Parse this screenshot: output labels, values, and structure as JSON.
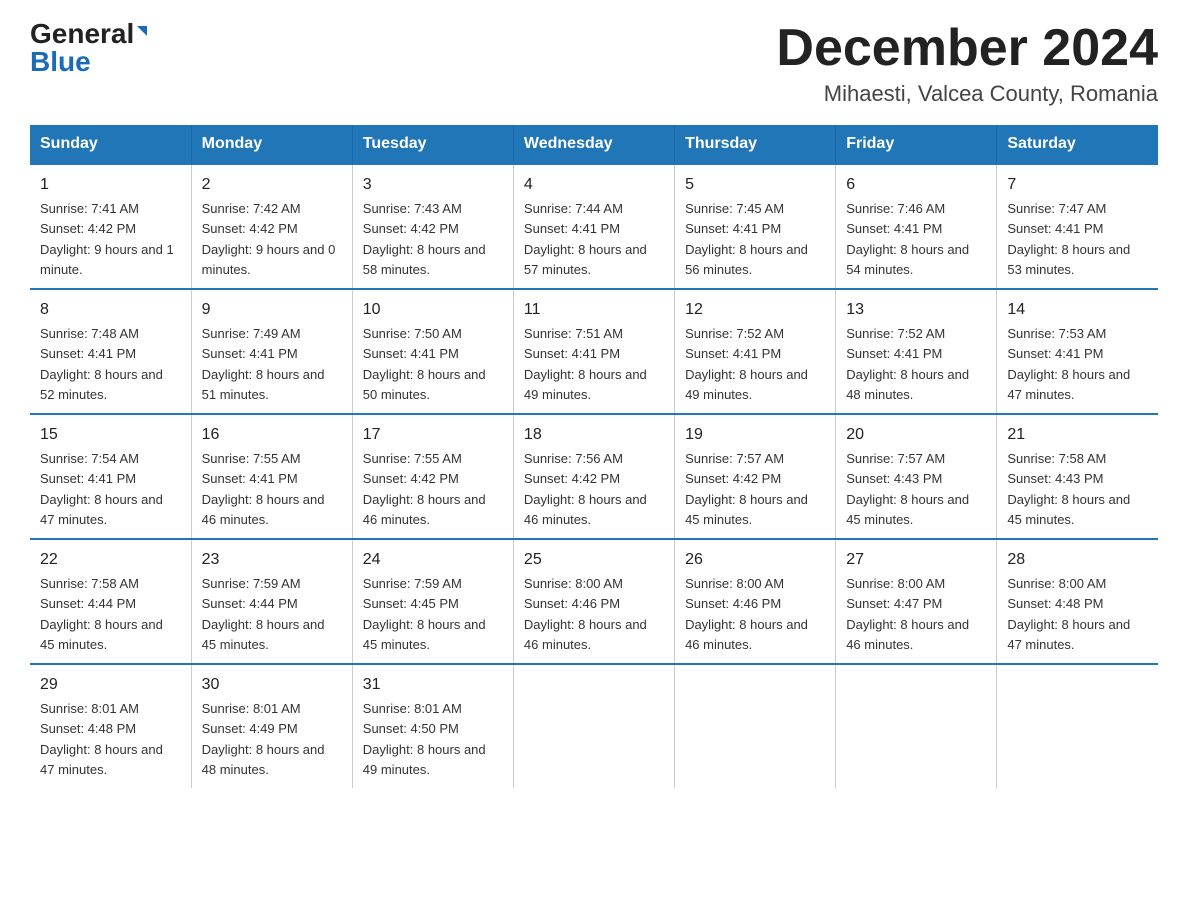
{
  "logo": {
    "general": "General",
    "blue": "Blue"
  },
  "title": "December 2024",
  "subtitle": "Mihaesti, Valcea County, Romania",
  "days_of_week": [
    "Sunday",
    "Monday",
    "Tuesday",
    "Wednesday",
    "Thursday",
    "Friday",
    "Saturday"
  ],
  "weeks": [
    [
      {
        "day": "1",
        "sunrise": "7:41 AM",
        "sunset": "4:42 PM",
        "daylight": "9 hours and 1 minute."
      },
      {
        "day": "2",
        "sunrise": "7:42 AM",
        "sunset": "4:42 PM",
        "daylight": "9 hours and 0 minutes."
      },
      {
        "day": "3",
        "sunrise": "7:43 AM",
        "sunset": "4:42 PM",
        "daylight": "8 hours and 58 minutes."
      },
      {
        "day": "4",
        "sunrise": "7:44 AM",
        "sunset": "4:41 PM",
        "daylight": "8 hours and 57 minutes."
      },
      {
        "day": "5",
        "sunrise": "7:45 AM",
        "sunset": "4:41 PM",
        "daylight": "8 hours and 56 minutes."
      },
      {
        "day": "6",
        "sunrise": "7:46 AM",
        "sunset": "4:41 PM",
        "daylight": "8 hours and 54 minutes."
      },
      {
        "day": "7",
        "sunrise": "7:47 AM",
        "sunset": "4:41 PM",
        "daylight": "8 hours and 53 minutes."
      }
    ],
    [
      {
        "day": "8",
        "sunrise": "7:48 AM",
        "sunset": "4:41 PM",
        "daylight": "8 hours and 52 minutes."
      },
      {
        "day": "9",
        "sunrise": "7:49 AM",
        "sunset": "4:41 PM",
        "daylight": "8 hours and 51 minutes."
      },
      {
        "day": "10",
        "sunrise": "7:50 AM",
        "sunset": "4:41 PM",
        "daylight": "8 hours and 50 minutes."
      },
      {
        "day": "11",
        "sunrise": "7:51 AM",
        "sunset": "4:41 PM",
        "daylight": "8 hours and 49 minutes."
      },
      {
        "day": "12",
        "sunrise": "7:52 AM",
        "sunset": "4:41 PM",
        "daylight": "8 hours and 49 minutes."
      },
      {
        "day": "13",
        "sunrise": "7:52 AM",
        "sunset": "4:41 PM",
        "daylight": "8 hours and 48 minutes."
      },
      {
        "day": "14",
        "sunrise": "7:53 AM",
        "sunset": "4:41 PM",
        "daylight": "8 hours and 47 minutes."
      }
    ],
    [
      {
        "day": "15",
        "sunrise": "7:54 AM",
        "sunset": "4:41 PM",
        "daylight": "8 hours and 47 minutes."
      },
      {
        "day": "16",
        "sunrise": "7:55 AM",
        "sunset": "4:41 PM",
        "daylight": "8 hours and 46 minutes."
      },
      {
        "day": "17",
        "sunrise": "7:55 AM",
        "sunset": "4:42 PM",
        "daylight": "8 hours and 46 minutes."
      },
      {
        "day": "18",
        "sunrise": "7:56 AM",
        "sunset": "4:42 PM",
        "daylight": "8 hours and 46 minutes."
      },
      {
        "day": "19",
        "sunrise": "7:57 AM",
        "sunset": "4:42 PM",
        "daylight": "8 hours and 45 minutes."
      },
      {
        "day": "20",
        "sunrise": "7:57 AM",
        "sunset": "4:43 PM",
        "daylight": "8 hours and 45 minutes."
      },
      {
        "day": "21",
        "sunrise": "7:58 AM",
        "sunset": "4:43 PM",
        "daylight": "8 hours and 45 minutes."
      }
    ],
    [
      {
        "day": "22",
        "sunrise": "7:58 AM",
        "sunset": "4:44 PM",
        "daylight": "8 hours and 45 minutes."
      },
      {
        "day": "23",
        "sunrise": "7:59 AM",
        "sunset": "4:44 PM",
        "daylight": "8 hours and 45 minutes."
      },
      {
        "day": "24",
        "sunrise": "7:59 AM",
        "sunset": "4:45 PM",
        "daylight": "8 hours and 45 minutes."
      },
      {
        "day": "25",
        "sunrise": "8:00 AM",
        "sunset": "4:46 PM",
        "daylight": "8 hours and 46 minutes."
      },
      {
        "day": "26",
        "sunrise": "8:00 AM",
        "sunset": "4:46 PM",
        "daylight": "8 hours and 46 minutes."
      },
      {
        "day": "27",
        "sunrise": "8:00 AM",
        "sunset": "4:47 PM",
        "daylight": "8 hours and 46 minutes."
      },
      {
        "day": "28",
        "sunrise": "8:00 AM",
        "sunset": "4:48 PM",
        "daylight": "8 hours and 47 minutes."
      }
    ],
    [
      {
        "day": "29",
        "sunrise": "8:01 AM",
        "sunset": "4:48 PM",
        "daylight": "8 hours and 47 minutes."
      },
      {
        "day": "30",
        "sunrise": "8:01 AM",
        "sunset": "4:49 PM",
        "daylight": "8 hours and 48 minutes."
      },
      {
        "day": "31",
        "sunrise": "8:01 AM",
        "sunset": "4:50 PM",
        "daylight": "8 hours and 49 minutes."
      },
      null,
      null,
      null,
      null
    ]
  ]
}
